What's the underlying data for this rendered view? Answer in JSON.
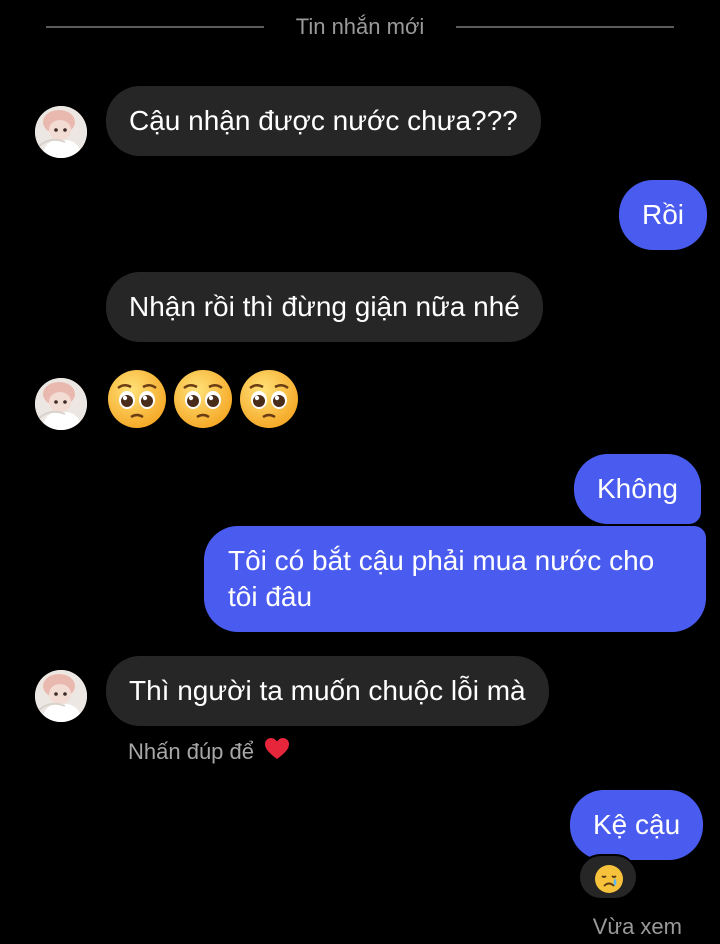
{
  "divider": {
    "label": "Tin nhắn mới"
  },
  "messages": [
    {
      "from": "them",
      "text": "Cậu nhận được nước chưa???"
    },
    {
      "from": "me",
      "text": "Rồi"
    },
    {
      "from": "them",
      "text": "Nhận rồi thì đừng giận nữa nhé"
    },
    {
      "from": "them",
      "emoji": [
        "pleading-face",
        "pleading-face",
        "pleading-face"
      ]
    },
    {
      "from": "me",
      "text": "Không"
    },
    {
      "from": "me",
      "text_line1": "Tôi có bắt cậu phải mua nước cho",
      "text_line2": "tôi đâu"
    },
    {
      "from": "them",
      "text": "Thì người ta muốn chuộc lỗi mà"
    },
    {
      "from": "me",
      "text": "Kệ cậu",
      "reaction": "crying-face"
    }
  ],
  "hint": {
    "text": "Nhấn đúp để",
    "icon": "heart-icon"
  },
  "status": {
    "seen": "Vừa xem"
  },
  "colors": {
    "background": "#000000",
    "incoming_bubble": "#262626",
    "outgoing_bubble": "#4a5cf0",
    "heart": "#e8263b"
  }
}
